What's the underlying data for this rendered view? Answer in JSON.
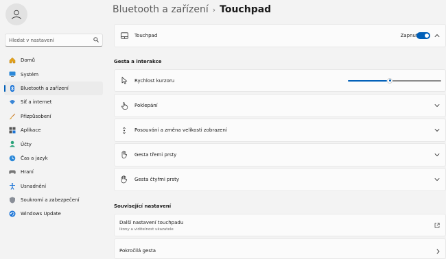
{
  "sidebar": {
    "search_placeholder": "Hledat v nastavení",
    "items": [
      {
        "label": "Domů",
        "icon": "home-icon"
      },
      {
        "label": "Systém",
        "icon": "system-icon"
      },
      {
        "label": "Bluetooth a zařízení",
        "icon": "bluetooth-icon",
        "active": true
      },
      {
        "label": "Síť a internet",
        "icon": "wifi-icon"
      },
      {
        "label": "Přizpůsobení",
        "icon": "brush-icon"
      },
      {
        "label": "Aplikace",
        "icon": "apps-icon"
      },
      {
        "label": "Účty",
        "icon": "accounts-icon"
      },
      {
        "label": "Čas a jazyk",
        "icon": "time-language-icon"
      },
      {
        "label": "Hraní",
        "icon": "gaming-icon"
      },
      {
        "label": "Usnadnění",
        "icon": "accessibility-icon"
      },
      {
        "label": "Soukromí a zabezpečení",
        "icon": "shield-icon"
      },
      {
        "label": "Windows Update",
        "icon": "update-icon"
      }
    ]
  },
  "header": {
    "breadcrumb": "Bluetooth a zařízení",
    "separator": "›",
    "title": "Touchpad"
  },
  "touchpad_card": {
    "label": "Touchpad",
    "toggle_state": "Zapnuto",
    "toggle_on": true
  },
  "gestures": {
    "heading": "Gesta a interakce",
    "cursor_speed": {
      "label": "Rychlost kurzoru",
      "value_fraction": 0.45
    },
    "rows": [
      {
        "label": "Poklepání",
        "icon": "tap-icon"
      },
      {
        "label": "Posouvání a změna velikosti zobrazení",
        "icon": "scroll-zoom-icon"
      },
      {
        "label": "Gesta třemi prsty",
        "icon": "three-finger-icon"
      },
      {
        "label": "Gesta čtyřmi prsty",
        "icon": "four-finger-icon"
      }
    ]
  },
  "related": {
    "heading": "Související nastavení",
    "more_touchpad": {
      "label": "Další nastavení touchpadu",
      "sub": "Ikony a viditelnost ukazatele"
    },
    "next_item": {
      "label": "Pokročilá gesta"
    }
  },
  "colors": {
    "accent": "#005fb8"
  }
}
